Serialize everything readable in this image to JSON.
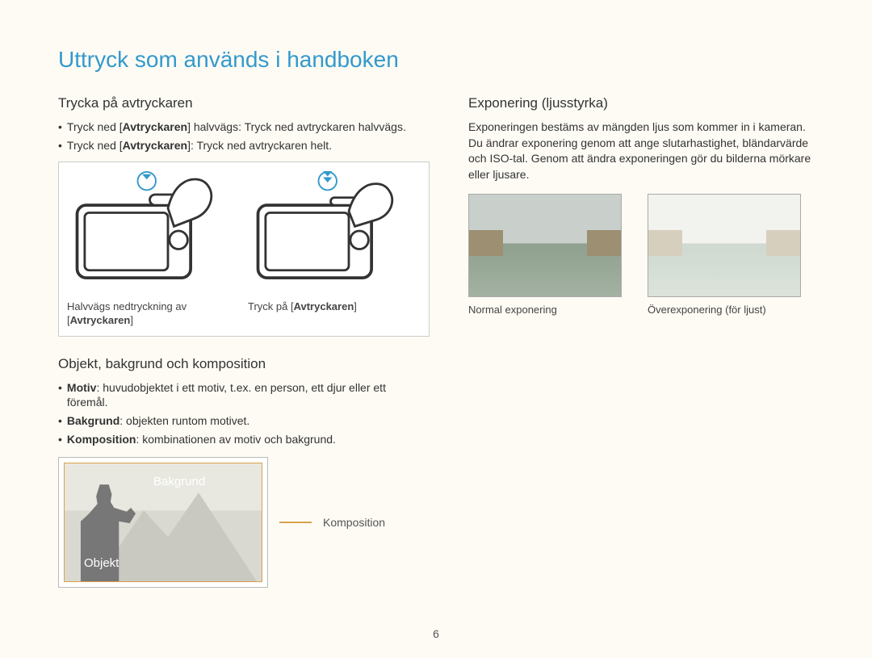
{
  "title": "Uttryck som används i handboken",
  "left": {
    "section1": {
      "heading": "Trycka på avtryckaren",
      "b1_pre": "Tryck ned [",
      "b1_mid": "Avtryckaren",
      "b1_post": "] halvvägs: Tryck ned avtryckaren halvvägs.",
      "b2_pre": "Tryck ned [",
      "b2_mid": "Avtryckaren",
      "b2_post": "]: Tryck ned avtryckaren helt.",
      "cap1_pre": "Halvvägs nedtryckning av [",
      "cap1_mid": "Avtryckaren",
      "cap1_post": "]",
      "cap2_pre": "Tryck på [",
      "cap2_mid": "Avtryckaren",
      "cap2_post": "]"
    },
    "section2": {
      "heading": "Objekt, bakgrund och komposition",
      "b1_label": "Motiv",
      "b1_text": ": huvudobjektet i ett motiv, t.ex. en person, ett djur eller ett föremål.",
      "b2_label": "Bakgrund",
      "b2_text": ": objekten runtom motivet.",
      "b3_label": "Komposition",
      "b3_text": ": kombinationen av motiv och bakgrund.",
      "diagram": {
        "bakgrund": "Bakgrund",
        "objekt": "Objekt",
        "komposition": "Komposition"
      }
    }
  },
  "right": {
    "heading": "Exponering (ljusstyrka)",
    "paragraph": "Exponeringen bestäms av mängden ljus som kommer in i kameran. Du ändrar exponering genom att ange slutarhastighet, bländarvärde och ISO-tal. Genom att ändra exponeringen gör du bilderna mörkare eller ljusare.",
    "cap_normal": "Normal exponering",
    "cap_over": "Överexponering (för ljust)"
  },
  "page_number": "6"
}
